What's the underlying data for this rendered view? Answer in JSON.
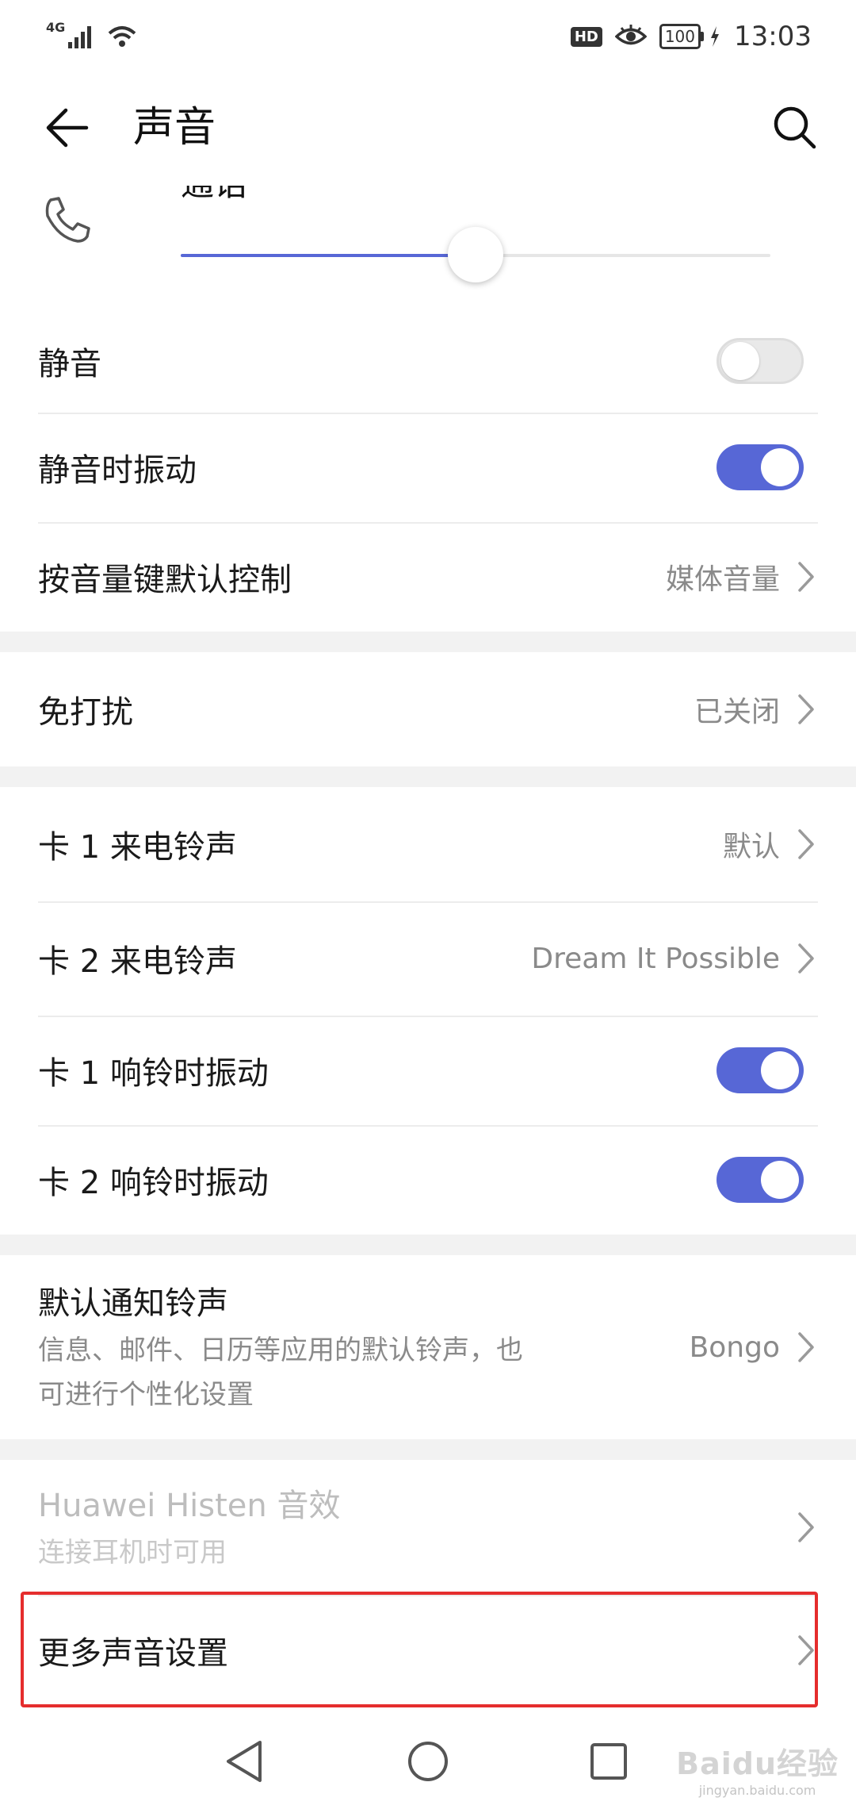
{
  "status_bar": {
    "network": "4G",
    "hd": "HD",
    "battery": "100",
    "time": "13:03"
  },
  "app_bar": {
    "title": "声音"
  },
  "volume": {
    "label": "通话",
    "level": 0.5
  },
  "group1": {
    "mute_label": "静音",
    "mute_on": false,
    "vibrate_mute_label": "静音时振动",
    "vibrate_mute_on": true,
    "volume_key_label": "按音量键默认控制",
    "volume_key_value": "媒体音量"
  },
  "group2": {
    "dnd_label": "免打扰",
    "dnd_value": "已关闭"
  },
  "group3": {
    "sim1_ringtone_label": "卡 1 来电铃声",
    "sim1_ringtone_value": "默认",
    "sim2_ringtone_label": "卡 2 来电铃声",
    "sim2_ringtone_value": "Dream It Possible",
    "sim1_vibrate_label": "卡 1 响铃时振动",
    "sim1_vibrate_on": true,
    "sim2_vibrate_label": "卡 2 响铃时振动",
    "sim2_vibrate_on": true
  },
  "group4": {
    "notify_label": "默认通知铃声",
    "notify_sub_line1": "信息、邮件、日历等应用的默认铃声，也",
    "notify_sub_line2": "可进行个性化设置",
    "notify_value": "Bongo"
  },
  "group5": {
    "histen_label": "Huawei Histen 音效",
    "histen_sub": "连接耳机时可用",
    "more_label": "更多声音设置"
  },
  "watermark": {
    "main": "Baidu经验",
    "sub": "jingyan.baidu.com"
  },
  "colors": {
    "accent": "#5767d6",
    "highlight": "#e52d2d"
  }
}
